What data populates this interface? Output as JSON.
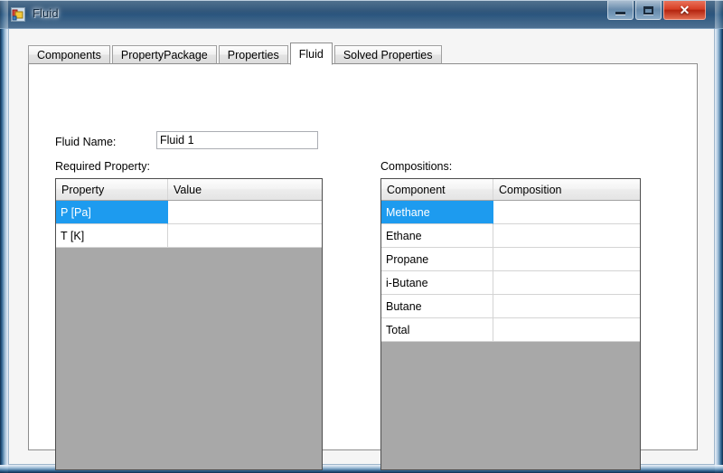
{
  "window": {
    "title": "Fluid",
    "icon": "winforms-app-icon",
    "buttons": {
      "minimize": "minimize-button",
      "maximize": "maximize-button",
      "close": "close-button",
      "close_glyph": "✕"
    }
  },
  "tabs": [
    {
      "label": "Components",
      "selected": false
    },
    {
      "label": "PropertyPackage",
      "selected": false
    },
    {
      "label": "Properties",
      "selected": false
    },
    {
      "label": "Fluid",
      "selected": true
    },
    {
      "label": "Solved Properties",
      "selected": false
    }
  ],
  "form": {
    "fluid_name_label": "Fluid Name:",
    "fluid_name_value": "Fluid 1",
    "fluid_name_placeholder": "",
    "required_property_label": "Required Property:",
    "compositions_label": "Compositions:"
  },
  "required_grid": {
    "columns": [
      "Property",
      "Value"
    ],
    "rows": [
      {
        "cells": [
          "P [Pa]",
          ""
        ],
        "selected": true
      },
      {
        "cells": [
          "T [K]",
          ""
        ],
        "selected": false
      }
    ]
  },
  "composition_grid": {
    "columns": [
      "Component",
      "Composition"
    ],
    "rows": [
      {
        "cells": [
          "Methane",
          ""
        ],
        "selected": true
      },
      {
        "cells": [
          "Ethane",
          ""
        ],
        "selected": false
      },
      {
        "cells": [
          "Propane",
          ""
        ],
        "selected": false
      },
      {
        "cells": [
          "i-Butane",
          ""
        ],
        "selected": false
      },
      {
        "cells": [
          "Butane",
          ""
        ],
        "selected": false
      },
      {
        "cells": [
          "Total",
          ""
        ],
        "selected": false
      }
    ]
  },
  "colors": {
    "selection": "#1d9bef",
    "grid_empty_background": "#a8a8a8",
    "grid_border": "#4d4d4d",
    "form_background": "#ffffff",
    "close_button": "#d83f26"
  }
}
